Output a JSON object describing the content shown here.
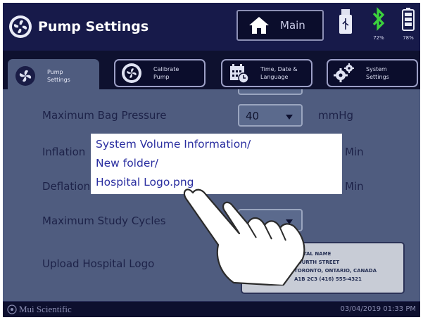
{
  "header": {
    "title": "Pump Settings",
    "main_button": "Main",
    "bluetooth_percent": "72%",
    "battery_percent": "78%"
  },
  "tabs": [
    {
      "label": "Pump\nSettings",
      "icon": "fan-gear-icon",
      "active": true
    },
    {
      "label": "Calibrate\nPump",
      "icon": "fan-gear-icon",
      "active": false
    },
    {
      "label": "Time, Date &\nLanguage",
      "icon": "calendar-clock-icon",
      "active": false
    },
    {
      "label": "System\nSettings",
      "icon": "gears-icon",
      "active": false
    }
  ],
  "settings": {
    "bag_pressure": {
      "label": "Maximum Bag Pressure",
      "value": "40",
      "unit": "mmHg"
    },
    "inflation": {
      "label": "Inflation",
      "unit": "Min"
    },
    "deflation": {
      "label": "Deflation",
      "unit": "Min"
    },
    "study_cycles": {
      "label": "Maximum Study Cycles"
    },
    "hospital_logo": {
      "label": "Upload Hospital Logo"
    }
  },
  "logo_preview": {
    "line1": "SPITAL NAME",
    "line2": "FOURTH STREET",
    "line3": "TORONTO, ONTARIO, CANADA",
    "line4": "A1B 2C3  (416) 555-4321"
  },
  "file_popup": {
    "line1": "System Volume Information/",
    "line2": "New folder/",
    "line3": "Hospital Logo.png"
  },
  "footer": {
    "brand": "Mui Scientific",
    "datetime": "03/04/2019 01:33 PM"
  },
  "colors": {
    "header_bg": "#171a4a",
    "content_bg": "#4f5c7f",
    "bluetooth": "#3cd23c",
    "popup_text": "#2a2ea0"
  }
}
